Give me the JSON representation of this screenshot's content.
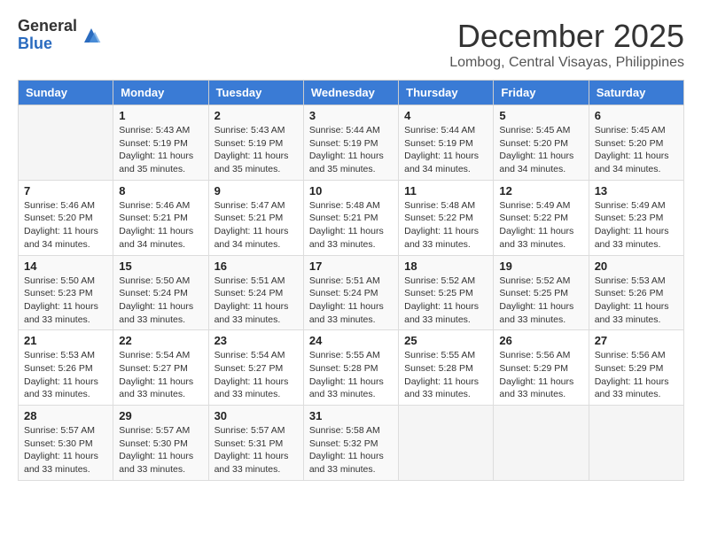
{
  "logo": {
    "general": "General",
    "blue": "Blue"
  },
  "title": {
    "month": "December 2025",
    "location": "Lombog, Central Visayas, Philippines"
  },
  "weekdays": [
    "Sunday",
    "Monday",
    "Tuesday",
    "Wednesday",
    "Thursday",
    "Friday",
    "Saturday"
  ],
  "weeks": [
    [
      {
        "day": "",
        "info": ""
      },
      {
        "day": "1",
        "info": "Sunrise: 5:43 AM\nSunset: 5:19 PM\nDaylight: 11 hours\nand 35 minutes."
      },
      {
        "day": "2",
        "info": "Sunrise: 5:43 AM\nSunset: 5:19 PM\nDaylight: 11 hours\nand 35 minutes."
      },
      {
        "day": "3",
        "info": "Sunrise: 5:44 AM\nSunset: 5:19 PM\nDaylight: 11 hours\nand 35 minutes."
      },
      {
        "day": "4",
        "info": "Sunrise: 5:44 AM\nSunset: 5:19 PM\nDaylight: 11 hours\nand 34 minutes."
      },
      {
        "day": "5",
        "info": "Sunrise: 5:45 AM\nSunset: 5:20 PM\nDaylight: 11 hours\nand 34 minutes."
      },
      {
        "day": "6",
        "info": "Sunrise: 5:45 AM\nSunset: 5:20 PM\nDaylight: 11 hours\nand 34 minutes."
      }
    ],
    [
      {
        "day": "7",
        "info": "Sunrise: 5:46 AM\nSunset: 5:20 PM\nDaylight: 11 hours\nand 34 minutes."
      },
      {
        "day": "8",
        "info": "Sunrise: 5:46 AM\nSunset: 5:21 PM\nDaylight: 11 hours\nand 34 minutes."
      },
      {
        "day": "9",
        "info": "Sunrise: 5:47 AM\nSunset: 5:21 PM\nDaylight: 11 hours\nand 34 minutes."
      },
      {
        "day": "10",
        "info": "Sunrise: 5:48 AM\nSunset: 5:21 PM\nDaylight: 11 hours\nand 33 minutes."
      },
      {
        "day": "11",
        "info": "Sunrise: 5:48 AM\nSunset: 5:22 PM\nDaylight: 11 hours\nand 33 minutes."
      },
      {
        "day": "12",
        "info": "Sunrise: 5:49 AM\nSunset: 5:22 PM\nDaylight: 11 hours\nand 33 minutes."
      },
      {
        "day": "13",
        "info": "Sunrise: 5:49 AM\nSunset: 5:23 PM\nDaylight: 11 hours\nand 33 minutes."
      }
    ],
    [
      {
        "day": "14",
        "info": "Sunrise: 5:50 AM\nSunset: 5:23 PM\nDaylight: 11 hours\nand 33 minutes."
      },
      {
        "day": "15",
        "info": "Sunrise: 5:50 AM\nSunset: 5:24 PM\nDaylight: 11 hours\nand 33 minutes."
      },
      {
        "day": "16",
        "info": "Sunrise: 5:51 AM\nSunset: 5:24 PM\nDaylight: 11 hours\nand 33 minutes."
      },
      {
        "day": "17",
        "info": "Sunrise: 5:51 AM\nSunset: 5:24 PM\nDaylight: 11 hours\nand 33 minutes."
      },
      {
        "day": "18",
        "info": "Sunrise: 5:52 AM\nSunset: 5:25 PM\nDaylight: 11 hours\nand 33 minutes."
      },
      {
        "day": "19",
        "info": "Sunrise: 5:52 AM\nSunset: 5:25 PM\nDaylight: 11 hours\nand 33 minutes."
      },
      {
        "day": "20",
        "info": "Sunrise: 5:53 AM\nSunset: 5:26 PM\nDaylight: 11 hours\nand 33 minutes."
      }
    ],
    [
      {
        "day": "21",
        "info": "Sunrise: 5:53 AM\nSunset: 5:26 PM\nDaylight: 11 hours\nand 33 minutes."
      },
      {
        "day": "22",
        "info": "Sunrise: 5:54 AM\nSunset: 5:27 PM\nDaylight: 11 hours\nand 33 minutes."
      },
      {
        "day": "23",
        "info": "Sunrise: 5:54 AM\nSunset: 5:27 PM\nDaylight: 11 hours\nand 33 minutes."
      },
      {
        "day": "24",
        "info": "Sunrise: 5:55 AM\nSunset: 5:28 PM\nDaylight: 11 hours\nand 33 minutes."
      },
      {
        "day": "25",
        "info": "Sunrise: 5:55 AM\nSunset: 5:28 PM\nDaylight: 11 hours\nand 33 minutes."
      },
      {
        "day": "26",
        "info": "Sunrise: 5:56 AM\nSunset: 5:29 PM\nDaylight: 11 hours\nand 33 minutes."
      },
      {
        "day": "27",
        "info": "Sunrise: 5:56 AM\nSunset: 5:29 PM\nDaylight: 11 hours\nand 33 minutes."
      }
    ],
    [
      {
        "day": "28",
        "info": "Sunrise: 5:57 AM\nSunset: 5:30 PM\nDaylight: 11 hours\nand 33 minutes."
      },
      {
        "day": "29",
        "info": "Sunrise: 5:57 AM\nSunset: 5:30 PM\nDaylight: 11 hours\nand 33 minutes."
      },
      {
        "day": "30",
        "info": "Sunrise: 5:57 AM\nSunset: 5:31 PM\nDaylight: 11 hours\nand 33 minutes."
      },
      {
        "day": "31",
        "info": "Sunrise: 5:58 AM\nSunset: 5:32 PM\nDaylight: 11 hours\nand 33 minutes."
      },
      {
        "day": "",
        "info": ""
      },
      {
        "day": "",
        "info": ""
      },
      {
        "day": "",
        "info": ""
      }
    ]
  ]
}
